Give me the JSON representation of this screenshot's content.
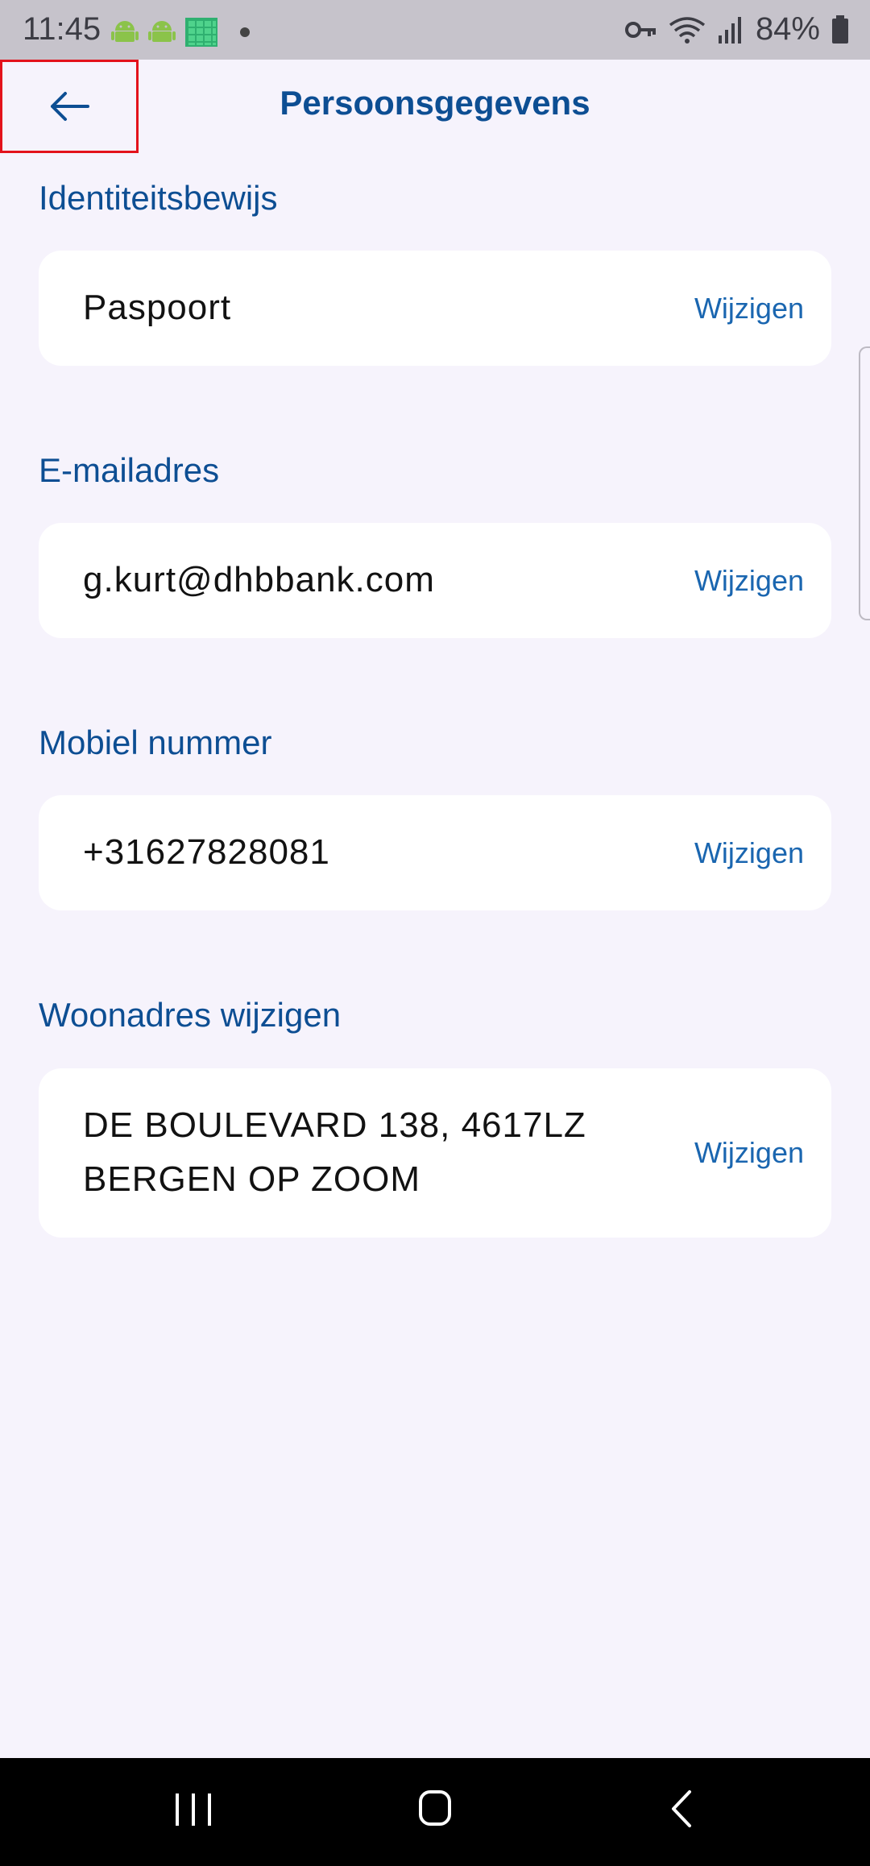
{
  "status_bar": {
    "time": "11:45",
    "battery": "84%",
    "icons": [
      "android-icon",
      "android-icon",
      "grid-app-icon",
      "dot-icon",
      "key-icon",
      "wifi-icon",
      "signal-icon",
      "battery-icon"
    ]
  },
  "header": {
    "title": "Persoonsgegevens",
    "back_icon": "arrow-left-icon"
  },
  "sections": [
    {
      "label": "Identiteitsbewijs",
      "value": "Paspoort",
      "action": "Wijzigen"
    },
    {
      "label": "E-mailadres",
      "value": "g.kurt@dhbbank.com",
      "action": "Wijzigen"
    },
    {
      "label": "Mobiel nummer",
      "value": "+31627828081",
      "action": "Wijzigen"
    },
    {
      "label": "Woonadres wijzigen",
      "value_line1": "DE BOULEVARD 138, 4617LZ",
      "value_line2": "BERGEN OP ZOOM",
      "action": "Wijzigen"
    }
  ],
  "colors": {
    "accent": "#0d4e93",
    "link": "#1a66b0",
    "background": "#f6f3fc",
    "highlight": "#e3121b"
  },
  "nav_bar": {
    "icons": [
      "recents-icon",
      "home-icon",
      "back-icon"
    ]
  }
}
